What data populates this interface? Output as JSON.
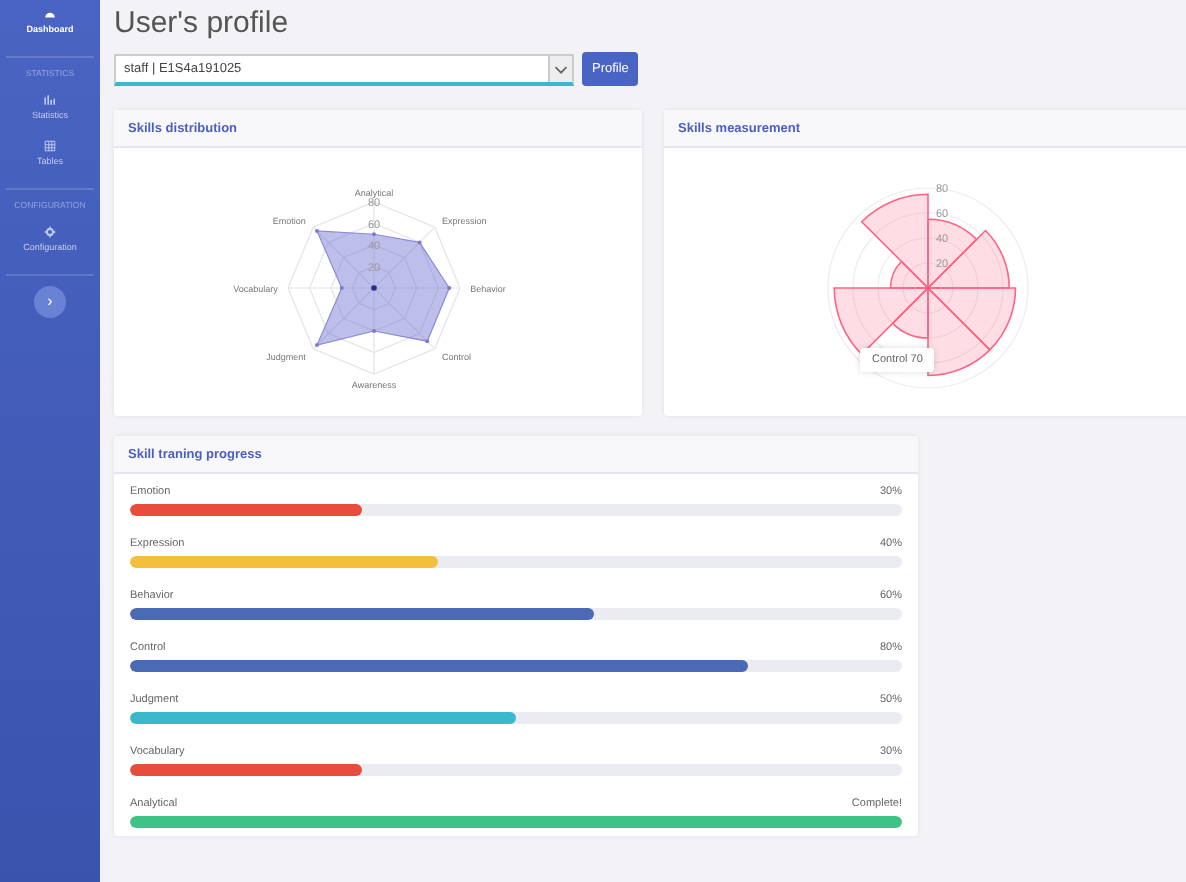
{
  "sidebar": {
    "items": [
      {
        "kind": "link",
        "label": "Dashboard",
        "selected": true
      },
      {
        "kind": "header",
        "label": "STATISTICS"
      },
      {
        "kind": "link",
        "label": "Statistics",
        "selected": false
      },
      {
        "kind": "link",
        "label": "Tables",
        "selected": false
      },
      {
        "kind": "header",
        "label": "CONFIGURATION"
      },
      {
        "kind": "link",
        "label": "Configuration",
        "selected": false
      },
      {
        "kind": "toggle",
        "label": "›"
      }
    ]
  },
  "page_title": "User's profile",
  "user_select": {
    "value": "staff | E1S4a191025"
  },
  "profile_button": "Profile",
  "skills_distribution": {
    "title": "Skills distribution",
    "axis_labels": [
      "Analytical",
      "Expression",
      "Behavior",
      "Control",
      "Awareness",
      "Judgment",
      "Vocabulary",
      "Emotion"
    ],
    "ticks": [
      "80",
      "60",
      "40",
      "20"
    ]
  },
  "skills_measurement": {
    "title": "Skills measurement",
    "ticks": [
      "80",
      "60",
      "40",
      "20"
    ],
    "tooltip": "Control 70"
  },
  "training": {
    "title": "Skill traning progress",
    "items": [
      {
        "label": "Emotion",
        "reading": "30%",
        "level": 0.3,
        "color": "#e74c3c"
      },
      {
        "label": "Expression",
        "reading": "40%",
        "level": 0.4,
        "color": "#f4c03c"
      },
      {
        "label": "Behavior",
        "reading": "60%",
        "level": 0.6,
        "color": "#4a6ab5"
      },
      {
        "label": "Control",
        "reading": "80%",
        "level": 0.8,
        "color": "#4a6ab5"
      },
      {
        "label": "Judgment",
        "reading": "50%",
        "level": 0.5,
        "color": "#3bb9cc"
      },
      {
        "label": "Vocabulary",
        "reading": "30%",
        "level": 0.3,
        "color": "#e74c3c"
      },
      {
        "label": "Analytical",
        "reading": "Complete!",
        "level": 1,
        "color": "#3cc385"
      }
    ]
  }
}
